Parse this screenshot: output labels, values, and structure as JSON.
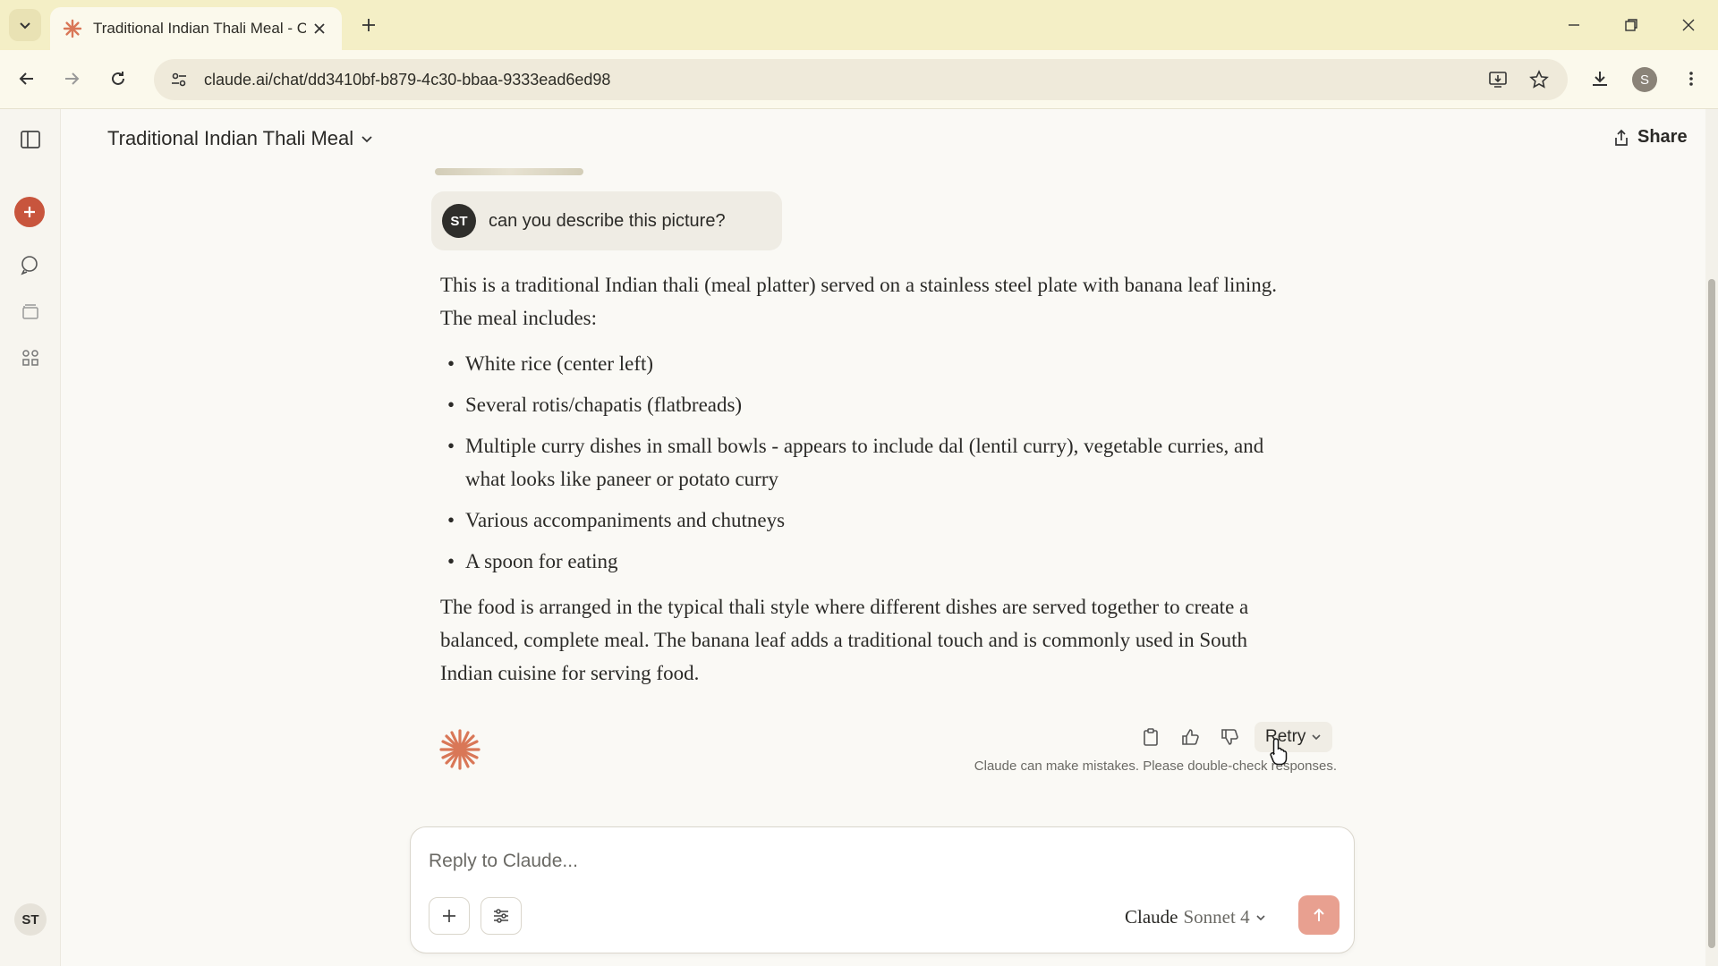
{
  "browser": {
    "tab_title": "Traditional Indian Thali Meal - C",
    "url": "claude.ai/chat/dd3410bf-b879-4c30-bbaa-9333ead6ed98",
    "profile_initial": "S"
  },
  "header": {
    "chat_title": "Traditional Indian Thali Meal",
    "share_label": "Share"
  },
  "sidebar": {
    "user_initials": "ST"
  },
  "conversation": {
    "user_initials": "ST",
    "user_message": "can you describe this picture?",
    "answer": {
      "intro": "This is a traditional Indian thali (meal platter) served on a stainless steel plate with banana leaf lining. The meal includes:",
      "items": [
        "White rice (center left)",
        "Several rotis/chapatis (flatbreads)",
        "Multiple curry dishes in small bowls - appears to include dal (lentil curry), vegetable curries, and what looks like paneer or potato curry",
        "Various accompaniments and chutneys",
        "A spoon for eating"
      ],
      "outro": "The food is arranged in the typical thali style where different dishes are served together to create a balanced, complete meal. The banana leaf adds a traditional touch and is commonly used in South Indian cuisine for serving food."
    },
    "retry_label": "Retry",
    "disclaimer": "Claude can make mistakes. Please double-check responses."
  },
  "composer": {
    "placeholder": "Reply to Claude...",
    "model_name": "Claude",
    "model_version": "Sonnet 4"
  },
  "colors": {
    "accent": "#c8553d",
    "tab_bar": "#f4efc6",
    "background": "#faf9f5"
  }
}
